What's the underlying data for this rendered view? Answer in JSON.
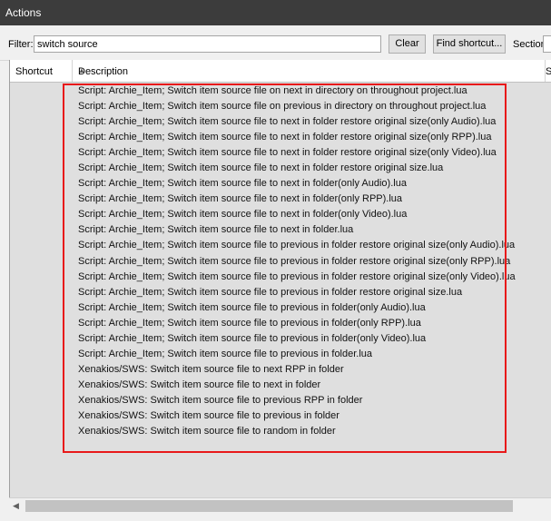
{
  "window": {
    "title": "Actions"
  },
  "toolbar": {
    "filter_label": "Filter:",
    "filter_value": "switch source",
    "clear_label": "Clear",
    "find_shortcut_label": "Find shortcut...",
    "section_label": "Section:"
  },
  "list": {
    "columns": {
      "shortcut": "Shortcut",
      "description": "Description",
      "section": "S"
    },
    "rows": [
      "Script: Archie_Item;  Switch item source file on next in directory on throughout project.lua",
      "Script: Archie_Item;  Switch item source file on previous in directory on throughout project.lua",
      "Script: Archie_Item;  Switch item source file to next in folder restore original size(only Audio).lua",
      "Script: Archie_Item;  Switch item source file to next in folder restore original size(only RPP).lua",
      "Script: Archie_Item;  Switch item source file to next in folder restore original size(only Video).lua",
      "Script: Archie_Item;  Switch item source file to next in folder restore original size.lua",
      "Script: Archie_Item;  Switch item source file to next in folder(only Audio).lua",
      "Script: Archie_Item;  Switch item source file to next in folder(only RPP).lua",
      "Script: Archie_Item;  Switch item source file to next in folder(only Video).lua",
      "Script: Archie_Item;  Switch item source file to next in folder.lua",
      "Script: Archie_Item;  Switch item source file to previous in folder restore original size(only Audio).lua",
      "Script: Archie_Item;  Switch item source file to previous in folder restore original size(only RPP).lua",
      "Script: Archie_Item;  Switch item source file to previous in folder restore original size(only Video).lua",
      "Script: Archie_Item;  Switch item source file to previous in folder restore original size.lua",
      "Script: Archie_Item;  Switch item source file to previous in folder(only Audio).lua",
      "Script: Archie_Item;  Switch item source file to previous in folder(only RPP).lua",
      "Script: Archie_Item;  Switch item source file to previous in folder(only Video).lua",
      "Script: Archie_Item;  Switch item source file to previous in folder.lua",
      "Xenakios/SWS: Switch item source file to next RPP in folder",
      "Xenakios/SWS: Switch item source file to next in folder",
      "Xenakios/SWS: Switch item source file to previous RPP in folder",
      "Xenakios/SWS: Switch item source file to previous in folder",
      "Xenakios/SWS: Switch item source file to random in folder"
    ]
  },
  "icons": {
    "sort": "sort-up-icon",
    "scroll_left": "scroll-left-arrow-icon"
  },
  "colors": {
    "titlebar": "#3c3c3c",
    "highlight": "#e8191a",
    "list_bg": "#dfdfdf"
  }
}
